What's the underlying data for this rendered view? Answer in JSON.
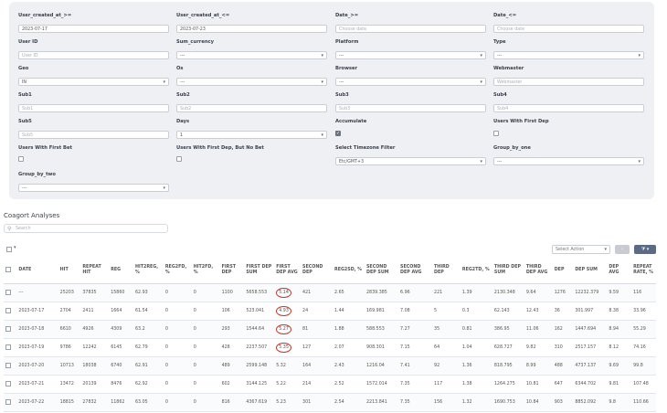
{
  "filters": {
    "user_created_at_gte": {
      "label": "User_created_at_>=",
      "value": "2023-07-17"
    },
    "user_created_at_lte": {
      "label": "User_created_at_<=",
      "value": "2023-07-23"
    },
    "date_gte": {
      "label": "Date_>=",
      "placeholder": "Choose date"
    },
    "date_lte": {
      "label": "Date_<=",
      "placeholder": "Choose date"
    },
    "user_id": {
      "label": "User ID",
      "placeholder": "User ID"
    },
    "sum_currency": {
      "label": "Sum_currency",
      "value": "---"
    },
    "platform": {
      "label": "Platform",
      "value": "---"
    },
    "type": {
      "label": "Type",
      "value": "---"
    },
    "geo": {
      "label": "Geo",
      "value": "IN"
    },
    "os": {
      "label": "Os",
      "value": "---"
    },
    "browser": {
      "label": "Browser",
      "value": "---"
    },
    "webmaster": {
      "label": "Webmaster",
      "placeholder": "Webmaster"
    },
    "sub1": {
      "label": "Sub1",
      "placeholder": "Sub1"
    },
    "sub2": {
      "label": "Sub2",
      "placeholder": "Sub2"
    },
    "sub3": {
      "label": "Sub3",
      "placeholder": "Sub3"
    },
    "sub4": {
      "label": "Sub4",
      "placeholder": "Sub4"
    },
    "sub5": {
      "label": "Sub5",
      "placeholder": "Sub5"
    },
    "days": {
      "label": "Days",
      "value": "1"
    },
    "accumulate": {
      "label": "Accumulate",
      "checked": true
    },
    "users_first_dep": {
      "label": "Users With First Dep",
      "checked": false
    },
    "users_first_bet": {
      "label": "Users With First Bet",
      "checked": false
    },
    "users_first_dep_no_bet": {
      "label": "Users With First Dep, But No Bet",
      "checked": false
    },
    "timezone": {
      "label": "Select Timezone Filter",
      "value": "Etc/GMT+3"
    },
    "group_by_one": {
      "label": "Group_by_one",
      "value": "---"
    },
    "group_by_two": {
      "label": "Group_by_two",
      "value": "---"
    }
  },
  "section_title": "Coagort Analyses",
  "search_placeholder": "Search",
  "toolbar": {
    "select_action": "Select Action",
    "go": "›",
    "filter": "⧩ ▾"
  },
  "columns": [
    "",
    "DATE",
    "HIT",
    "REPEAT HIT",
    "REG",
    "HIT2REG, %",
    "REG2FD, %",
    "HIT2FD, %",
    "FIRST DEP",
    "FIRST DEP SUM",
    "FIRST DEP AVG",
    "SECOND DEP",
    "REG2SD, %",
    "SECOND DEP SUM",
    "SECOND DEP AVG",
    "THIRD DEP",
    "REG2TD, %",
    "THIRD DEP SUM",
    "THIRD DEP AVG",
    "DEP",
    "DEP SUM",
    "DEP AVG",
    "REPEAT RATE, %"
  ],
  "rows": [
    [
      "",
      "---",
      "25203",
      "37835",
      "15860",
      "62.93",
      "0",
      "0",
      "1100",
      "5658.553",
      "5.14",
      "421",
      "2.65",
      "2839.385",
      "6.96",
      "221",
      "1.39",
      "2130.348",
      "9.64",
      "1276",
      "12232.379",
      "9.59",
      "116"
    ],
    [
      "",
      "2023-07-17",
      "2704",
      "2411",
      "1664",
      "61.54",
      "0",
      "0",
      "106",
      "523.041",
      "4.93",
      "24",
      "1.44",
      "169.981",
      "7.08",
      "5",
      "0.3",
      "62.143",
      "12.43",
      "36",
      "301.997",
      "8.38",
      "33.96"
    ],
    [
      "",
      "2023-07-18",
      "6610",
      "4926",
      "4309",
      "63.2",
      "0",
      "0",
      "293",
      "1544.64",
      "5.27",
      "81",
      "1.88",
      "588.553",
      "7.27",
      "35",
      "0.81",
      "386.95",
      "11.06",
      "162",
      "1447.694",
      "8.94",
      "55.29"
    ],
    [
      "",
      "2023-07-19",
      "9786",
      "12242",
      "6145",
      "62.79",
      "0",
      "0",
      "428",
      "2237.507",
      "5.35",
      "127",
      "2.07",
      "908.301",
      "7.15",
      "64",
      "1.04",
      "628.727",
      "9.82",
      "310",
      "2517.157",
      "8.12",
      "74.16"
    ],
    [
      "",
      "2023-07-20",
      "10713",
      "18038",
      "6740",
      "62.91",
      "0",
      "0",
      "489",
      "2599.148",
      "5.32",
      "164",
      "2.43",
      "1216.04",
      "7.41",
      "92",
      "1.36",
      "818.795",
      "8.99",
      "488",
      "4737.137",
      "9.69",
      "99.8"
    ],
    [
      "",
      "2023-07-21",
      "13472",
      "20139",
      "8476",
      "62.92",
      "0",
      "0",
      "602",
      "3144.125",
      "5.22",
      "214",
      "2.52",
      "1572.014",
      "7.35",
      "117",
      "1.38",
      "1264.275",
      "10.81",
      "647",
      "6344.702",
      "9.81",
      "107.48"
    ],
    [
      "",
      "2023-07-22",
      "18815",
      "27832",
      "11862",
      "63.05",
      "0",
      "0",
      "816",
      "4367.619",
      "5.23",
      "301",
      "2.54",
      "2213.841",
      "7.35",
      "156",
      "1.32",
      "1690.753",
      "10.84",
      "903",
      "8852.092",
      "9.8",
      "110.66"
    ]
  ],
  "highlight_column": 10,
  "highlight_rows": [
    0,
    1,
    2,
    3
  ]
}
